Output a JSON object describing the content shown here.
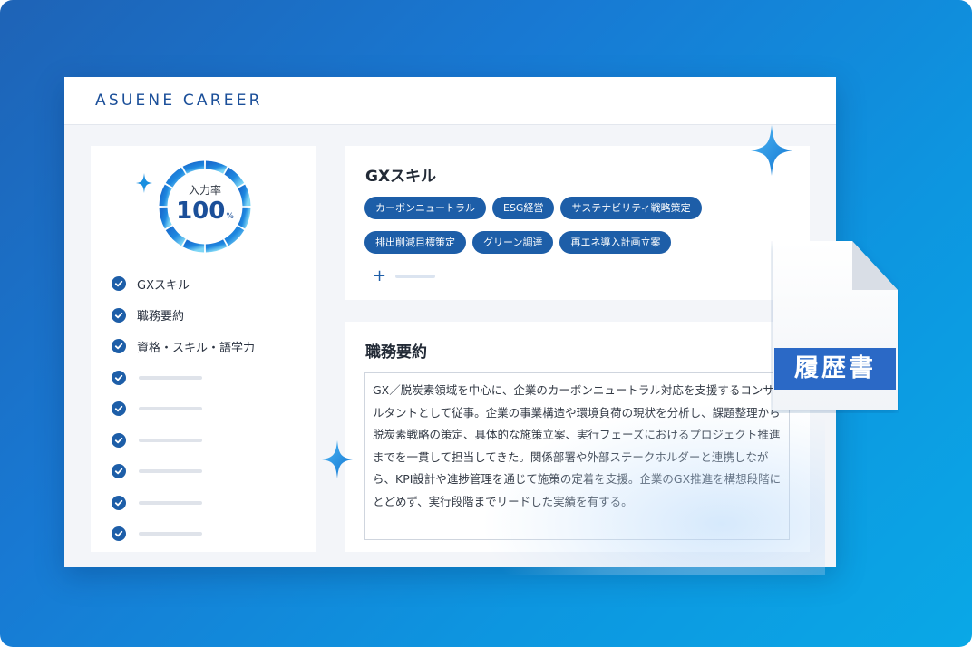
{
  "app": {
    "brand": "ASUENE CAREER"
  },
  "progress": {
    "label": "入力率",
    "value": "100",
    "unit": "%",
    "fraction": 1.0
  },
  "checklist": [
    {
      "label": "GXスキル",
      "done": true
    },
    {
      "label": "職務要約",
      "done": true
    },
    {
      "label": "資格・スキル・語学力",
      "done": true
    },
    {
      "label": "",
      "done": true
    },
    {
      "label": "",
      "done": true
    },
    {
      "label": "",
      "done": true
    },
    {
      "label": "",
      "done": true
    },
    {
      "label": "",
      "done": true
    },
    {
      "label": "",
      "done": true
    }
  ],
  "skills": {
    "title": "GXスキル",
    "tags": [
      "カーボンニュートラル",
      "ESG経営",
      "サステナビリティ戦略策定",
      "排出削減目標策定",
      "グリーン調達",
      "再エネ導入計画立案"
    ],
    "add_icon": "plus-icon"
  },
  "summary": {
    "title": "職務要約",
    "text": "GX／脱炭素領域を中心に、企業のカーボンニュートラル対応を支援するコンサルタントとして従事。企業の事業構造や環境負荷の現状を分析し、課題整理から脱炭素戦略の策定、具体的な施策立案、実行フェーズにおけるプロジェクト推進までを一貫して担当してきた。関係部署や外部ステークホルダーと連携しながら、KPI設計や進捗管理を通じて施策の定着を支援。企業のGX推進を構想段階にとどめず、実行段階までリードした実績を有する。"
  },
  "document": {
    "label": "履歴書",
    "icon": "document-icon"
  },
  "colors": {
    "brand": "#1b4f99",
    "tag_bg": "#1d5ea8",
    "background_start": "#1e63b6",
    "background_end": "#0aa8e6",
    "doc_band": "#2b69c6",
    "sparkle": "#1a8fe0"
  }
}
